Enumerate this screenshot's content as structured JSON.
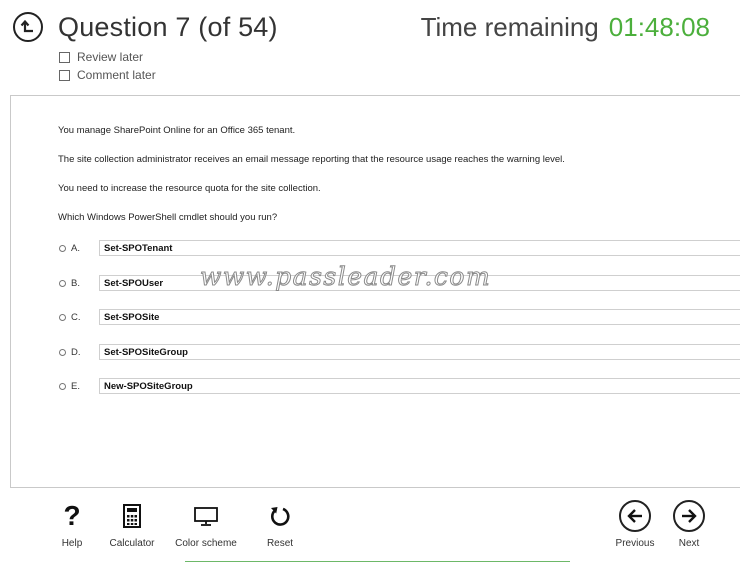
{
  "header": {
    "question_title": "Question 7 (of 54)",
    "review_later": "Review later",
    "comment_later": "Comment later",
    "time_label": "Time remaining",
    "time_value": "01:48:08"
  },
  "question": {
    "paragraphs": [
      "You manage SharePoint Online for an Office 365 tenant.",
      "The site collection administrator receives an email message reporting that the resource usage reaches the warning level.",
      "You need to increase the resource quota for the site collection.",
      "Which Windows PowerShell cmdlet should you run?"
    ],
    "options": [
      {
        "letter": "A.",
        "text": "Set-SPOTenant"
      },
      {
        "letter": "B.",
        "text": "Set-SPOUser"
      },
      {
        "letter": "C.",
        "text": "Set-SPOSite"
      },
      {
        "letter": "D.",
        "text": "Set-SPOSiteGroup"
      },
      {
        "letter": "E.",
        "text": "New-SPOSiteGroup"
      }
    ]
  },
  "watermark": "www.passleader.com",
  "toolbar": {
    "help": "Help",
    "calculator": "Calculator",
    "color_scheme": "Color scheme",
    "reset": "Reset",
    "previous": "Previous",
    "next": "Next"
  },
  "colors": {
    "timer_green": "#4caf3c",
    "progress_green": "#6db868"
  },
  "icons": {
    "back": "up-arrow-circle-icon",
    "help": "question-mark-icon",
    "calculator": "calculator-icon",
    "color_scheme": "monitor-icon",
    "reset": "rotate-arrow-icon",
    "previous": "left-arrow-circle-icon",
    "next": "right-arrow-circle-icon"
  }
}
